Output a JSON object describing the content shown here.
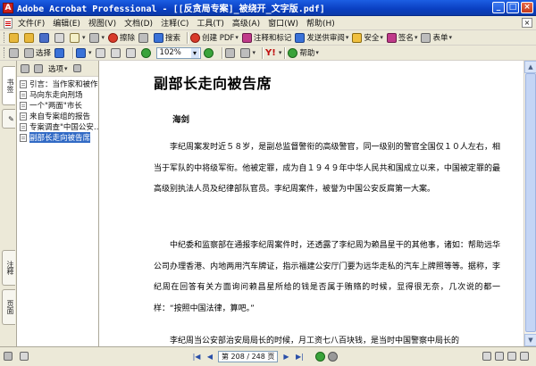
{
  "window": {
    "title": "Adobe Acrobat Professional - [[反贪局专案]_被绕开_文字版.pdf]",
    "buttons": [
      "_",
      "□",
      "×"
    ]
  },
  "menu": [
    "文件(F)",
    "编辑(E)",
    "视图(V)",
    "文档(D)",
    "注释(C)",
    "工具(T)",
    "高级(A)",
    "窗口(W)",
    "帮助(H)"
  ],
  "toolbar1": {
    "erase": "擦除",
    "search": "搜索",
    "create_pdf": "创建 PDF",
    "review": "注释和标记",
    "send_review": "发送供审阅",
    "secure": "安全",
    "sign": "签名",
    "forms": "表单"
  },
  "toolbar2": {
    "select": "选择",
    "zoom": "102%",
    "help": "帮助"
  },
  "left_tabs": [
    "书签",
    "签名",
    "注释",
    "页面"
  ],
  "bookmarks_panel": {
    "options": "选项",
    "items": [
      "引言：当作家和被作家",
      "马向东走向刑场",
      "一个\"两面\"市长",
      "来自专案组的报告",
      "专案调查\"中国公安…",
      "副部长走向被告席"
    ],
    "selected_index": 5
  },
  "document": {
    "title": "副部长走向被告席",
    "author": "海剑",
    "paragraphs": [
      "李纪周案发时近５８岁，是副总监督警衔的高级警官，同一级别的警官全国仅１０人左右，相当于军队的中将级军衔。他被定罪，成为自１９４９年中华人民共和国成立以来，中国被定罪的最高级别执法人员及纪律部队官员。李纪周案件，被誉为中国公安反腐第一大案。",
      "中纪委和监察部在通报李纪周案件时，还透露了李纪周为赖昌星干的其他事，诸如：帮助远华公司办理香港、内地两用汽车牌证，指示福建公安厅门要为远华走私的汽车上牌照等等。据称，李纪周在回答有关方面询问赖昌星所给的钱是否属于贿赂的时候，显得很无奈，几次说的都一样：“按照中国法律，算吧。”",
      "李纪周当公安部治安局局长的时候，月工资七八百块钱，是当时中国警察中局长的"
    ]
  },
  "status": {
    "page_box": "第 208 / 248 页"
  },
  "colors": {
    "titlebar": "#0a3fc1",
    "chrome": "#ece9d8",
    "selection": "#316ac5"
  }
}
